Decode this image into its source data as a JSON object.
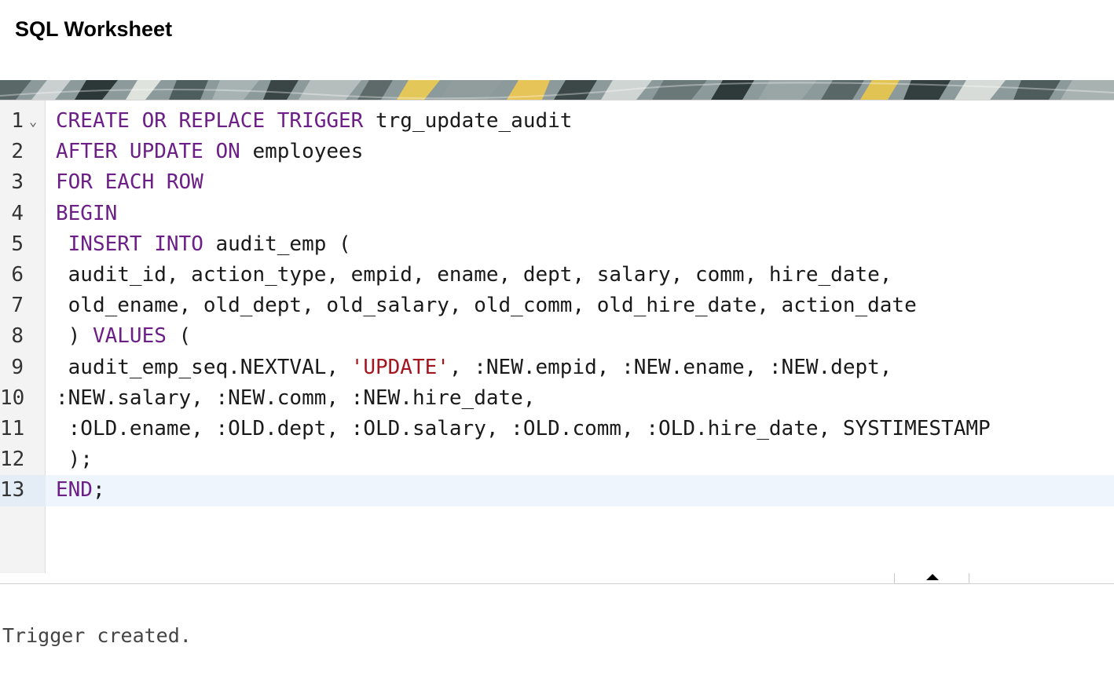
{
  "header": {
    "title": "SQL Worksheet"
  },
  "editor": {
    "lines": [
      {
        "num": "1",
        "segments": [
          [
            "kw",
            "CREATE OR REPLACE TRIGGER"
          ],
          [
            "t",
            " trg_update_audit"
          ]
        ]
      },
      {
        "num": "2",
        "segments": [
          [
            "kw",
            "AFTER UPDATE ON"
          ],
          [
            "t",
            " employees"
          ]
        ]
      },
      {
        "num": "3",
        "segments": [
          [
            "kw",
            "FOR EACH ROW"
          ]
        ]
      },
      {
        "num": "4",
        "segments": [
          [
            "kw",
            "BEGIN"
          ]
        ]
      },
      {
        "num": "5",
        "segments": [
          [
            "t",
            " "
          ],
          [
            "kw",
            "INSERT INTO"
          ],
          [
            "t",
            " audit_emp ("
          ]
        ]
      },
      {
        "num": "6",
        "segments": [
          [
            "t",
            " audit_id, action_type, empid, ename, dept, salary, comm, hire_date,"
          ]
        ]
      },
      {
        "num": "7",
        "segments": [
          [
            "t",
            " old_ename, old_dept, old_salary, old_comm, old_hire_date, action_date"
          ]
        ]
      },
      {
        "num": "8",
        "segments": [
          [
            "t",
            " ) "
          ],
          [
            "kw",
            "VALUES"
          ],
          [
            "t",
            " ("
          ]
        ]
      },
      {
        "num": "9",
        "segments": [
          [
            "t",
            " audit_emp_seq.NEXTVAL, "
          ],
          [
            "str",
            "'UPDATE'"
          ],
          [
            "t",
            ", :NEW.empid, :NEW.ename, :NEW.dept,"
          ]
        ]
      },
      {
        "num": "10",
        "segments": [
          [
            "t",
            ":NEW.salary, :NEW.comm, :NEW.hire_date,"
          ]
        ]
      },
      {
        "num": "11",
        "segments": [
          [
            "t",
            " :OLD.ename, :OLD.dept, :OLD.salary, :OLD.comm, :OLD.hire_date, SYSTIMESTAMP"
          ]
        ]
      },
      {
        "num": "12",
        "segments": [
          [
            "t",
            " );"
          ]
        ]
      },
      {
        "num": "13",
        "segments": [
          [
            "kw",
            "END"
          ],
          [
            "t",
            ";"
          ]
        ]
      }
    ],
    "active_line": "13",
    "fold_icon": "chevron-down-icon"
  },
  "splitter": {
    "icon": "caret-up-icon"
  },
  "output": {
    "text": "Trigger created."
  },
  "colors": {
    "keyword": "#6c1f86",
    "string": "#a3161f",
    "active_line": "#eef5fd"
  }
}
